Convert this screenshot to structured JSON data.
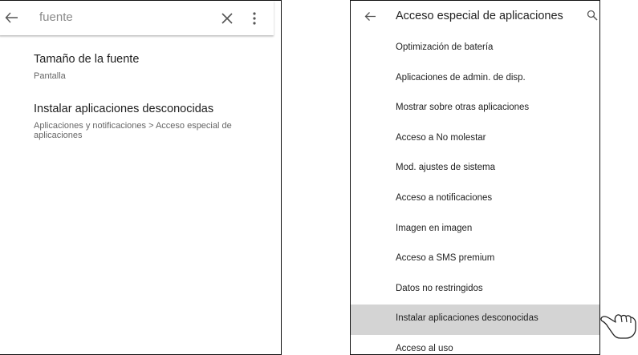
{
  "left_screen": {
    "search_query": "fuente",
    "results": [
      {
        "title": "Tamaño de la fuente",
        "subtitle": "Pantalla"
      },
      {
        "title": "Instalar aplicaciones desconocidas",
        "subtitle": "Aplicaciones y notificaciones > Acceso especial de aplicaciones"
      }
    ]
  },
  "right_screen": {
    "title": "Acceso especial de aplicaciones",
    "items": [
      {
        "label": "Optimización de batería"
      },
      {
        "label": "Aplicaciones de admin. de disp."
      },
      {
        "label": "Mostrar sobre otras aplicaciones"
      },
      {
        "label": "Acceso a No molestar"
      },
      {
        "label": "Mod. ajustes de sistema"
      },
      {
        "label": "Acceso a notificaciones"
      },
      {
        "label": "Imagen en imagen"
      },
      {
        "label": "Acceso a SMS premium"
      },
      {
        "label": "Datos no restringidos"
      },
      {
        "label": "Instalar aplicaciones desconocidas",
        "selected": true
      },
      {
        "label": "Acceso al uso"
      }
    ]
  },
  "icons": {
    "back": "arrow-left-icon",
    "clear": "close-icon",
    "more": "more-vert-icon",
    "search": "search-icon",
    "pointer": "pointing-hand-icon"
  },
  "colors": {
    "selected_row": "#d4d4d4",
    "search_text": "#8a8a8a"
  }
}
